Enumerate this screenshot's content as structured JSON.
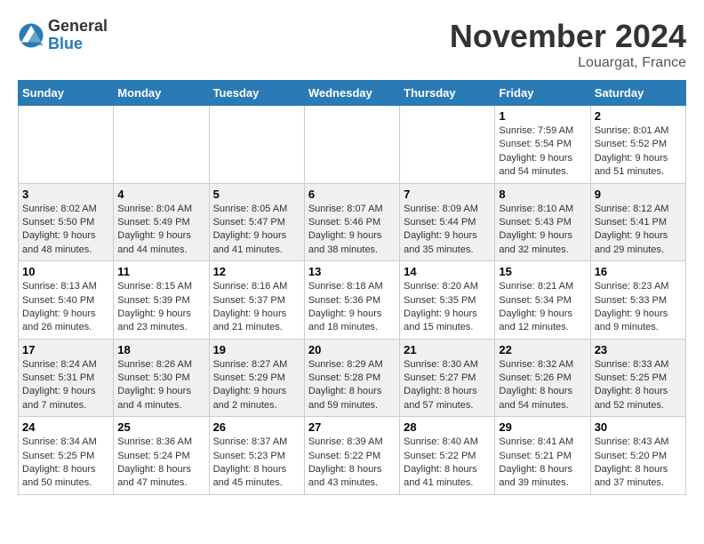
{
  "header": {
    "logo_general": "General",
    "logo_blue": "Blue",
    "month_title": "November 2024",
    "location": "Louargat, France"
  },
  "weekdays": [
    "Sunday",
    "Monday",
    "Tuesday",
    "Wednesday",
    "Thursday",
    "Friday",
    "Saturday"
  ],
  "weeks": [
    [
      {
        "day": "",
        "info": ""
      },
      {
        "day": "",
        "info": ""
      },
      {
        "day": "",
        "info": ""
      },
      {
        "day": "",
        "info": ""
      },
      {
        "day": "",
        "info": ""
      },
      {
        "day": "1",
        "info": "Sunrise: 7:59 AM\nSunset: 5:54 PM\nDaylight: 9 hours\nand 54 minutes."
      },
      {
        "day": "2",
        "info": "Sunrise: 8:01 AM\nSunset: 5:52 PM\nDaylight: 9 hours\nand 51 minutes."
      }
    ],
    [
      {
        "day": "3",
        "info": "Sunrise: 8:02 AM\nSunset: 5:50 PM\nDaylight: 9 hours\nand 48 minutes."
      },
      {
        "day": "4",
        "info": "Sunrise: 8:04 AM\nSunset: 5:49 PM\nDaylight: 9 hours\nand 44 minutes."
      },
      {
        "day": "5",
        "info": "Sunrise: 8:05 AM\nSunset: 5:47 PM\nDaylight: 9 hours\nand 41 minutes."
      },
      {
        "day": "6",
        "info": "Sunrise: 8:07 AM\nSunset: 5:46 PM\nDaylight: 9 hours\nand 38 minutes."
      },
      {
        "day": "7",
        "info": "Sunrise: 8:09 AM\nSunset: 5:44 PM\nDaylight: 9 hours\nand 35 minutes."
      },
      {
        "day": "8",
        "info": "Sunrise: 8:10 AM\nSunset: 5:43 PM\nDaylight: 9 hours\nand 32 minutes."
      },
      {
        "day": "9",
        "info": "Sunrise: 8:12 AM\nSunset: 5:41 PM\nDaylight: 9 hours\nand 29 minutes."
      }
    ],
    [
      {
        "day": "10",
        "info": "Sunrise: 8:13 AM\nSunset: 5:40 PM\nDaylight: 9 hours\nand 26 minutes."
      },
      {
        "day": "11",
        "info": "Sunrise: 8:15 AM\nSunset: 5:39 PM\nDaylight: 9 hours\nand 23 minutes."
      },
      {
        "day": "12",
        "info": "Sunrise: 8:16 AM\nSunset: 5:37 PM\nDaylight: 9 hours\nand 21 minutes."
      },
      {
        "day": "13",
        "info": "Sunrise: 8:18 AM\nSunset: 5:36 PM\nDaylight: 9 hours\nand 18 minutes."
      },
      {
        "day": "14",
        "info": "Sunrise: 8:20 AM\nSunset: 5:35 PM\nDaylight: 9 hours\nand 15 minutes."
      },
      {
        "day": "15",
        "info": "Sunrise: 8:21 AM\nSunset: 5:34 PM\nDaylight: 9 hours\nand 12 minutes."
      },
      {
        "day": "16",
        "info": "Sunrise: 8:23 AM\nSunset: 5:33 PM\nDaylight: 9 hours\nand 9 minutes."
      }
    ],
    [
      {
        "day": "17",
        "info": "Sunrise: 8:24 AM\nSunset: 5:31 PM\nDaylight: 9 hours\nand 7 minutes."
      },
      {
        "day": "18",
        "info": "Sunrise: 8:26 AM\nSunset: 5:30 PM\nDaylight: 9 hours\nand 4 minutes."
      },
      {
        "day": "19",
        "info": "Sunrise: 8:27 AM\nSunset: 5:29 PM\nDaylight: 9 hours\nand 2 minutes."
      },
      {
        "day": "20",
        "info": "Sunrise: 8:29 AM\nSunset: 5:28 PM\nDaylight: 8 hours\nand 59 minutes."
      },
      {
        "day": "21",
        "info": "Sunrise: 8:30 AM\nSunset: 5:27 PM\nDaylight: 8 hours\nand 57 minutes."
      },
      {
        "day": "22",
        "info": "Sunrise: 8:32 AM\nSunset: 5:26 PM\nDaylight: 8 hours\nand 54 minutes."
      },
      {
        "day": "23",
        "info": "Sunrise: 8:33 AM\nSunset: 5:25 PM\nDaylight: 8 hours\nand 52 minutes."
      }
    ],
    [
      {
        "day": "24",
        "info": "Sunrise: 8:34 AM\nSunset: 5:25 PM\nDaylight: 8 hours\nand 50 minutes."
      },
      {
        "day": "25",
        "info": "Sunrise: 8:36 AM\nSunset: 5:24 PM\nDaylight: 8 hours\nand 47 minutes."
      },
      {
        "day": "26",
        "info": "Sunrise: 8:37 AM\nSunset: 5:23 PM\nDaylight: 8 hours\nand 45 minutes."
      },
      {
        "day": "27",
        "info": "Sunrise: 8:39 AM\nSunset: 5:22 PM\nDaylight: 8 hours\nand 43 minutes."
      },
      {
        "day": "28",
        "info": "Sunrise: 8:40 AM\nSunset: 5:22 PM\nDaylight: 8 hours\nand 41 minutes."
      },
      {
        "day": "29",
        "info": "Sunrise: 8:41 AM\nSunset: 5:21 PM\nDaylight: 8 hours\nand 39 minutes."
      },
      {
        "day": "30",
        "info": "Sunrise: 8:43 AM\nSunset: 5:20 PM\nDaylight: 8 hours\nand 37 minutes."
      }
    ]
  ]
}
